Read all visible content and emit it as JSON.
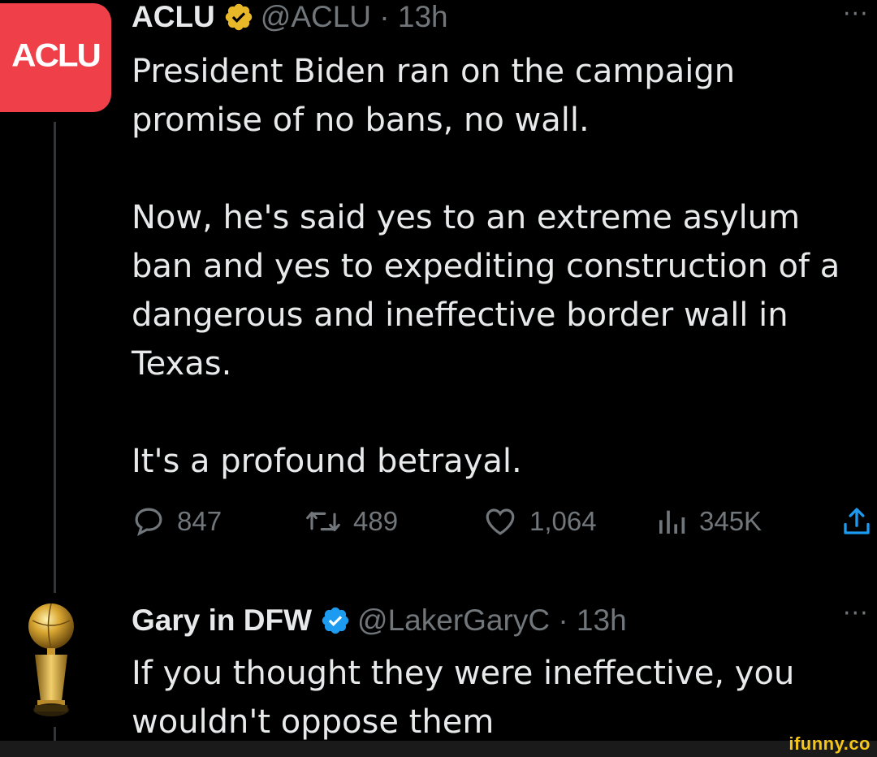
{
  "tweet1": {
    "avatar_text": "ACLU",
    "name": "ACLU",
    "handle_time": "@ACLU · 13h",
    "more": "···",
    "text": "President Biden ran on the campaign\npromise of no bans, no wall.\n\nNow, he's said yes to an extreme asylum\nban and yes to expediting construction of a\ndangerous and ineffective border wall in\nTexas.\n\nIt's a profound betrayal.",
    "actions": {
      "replies": "847",
      "reposts": "489",
      "likes": "1,064",
      "views": "345K"
    }
  },
  "tweet2": {
    "name": "Gary in DFW",
    "handle_time": "@LakerGaryC · 13h",
    "more": "···",
    "text": "If you thought they were ineffective, you\nwouldn't oppose them"
  },
  "watermark": "ifunny.co",
  "colors": {
    "background": "#000000",
    "text": "#e7e9ea",
    "secondary": "#71767b",
    "aclu_red": "#ef404a",
    "gold_badge": "#e8b829",
    "blue_badge": "#1d9bf0"
  }
}
